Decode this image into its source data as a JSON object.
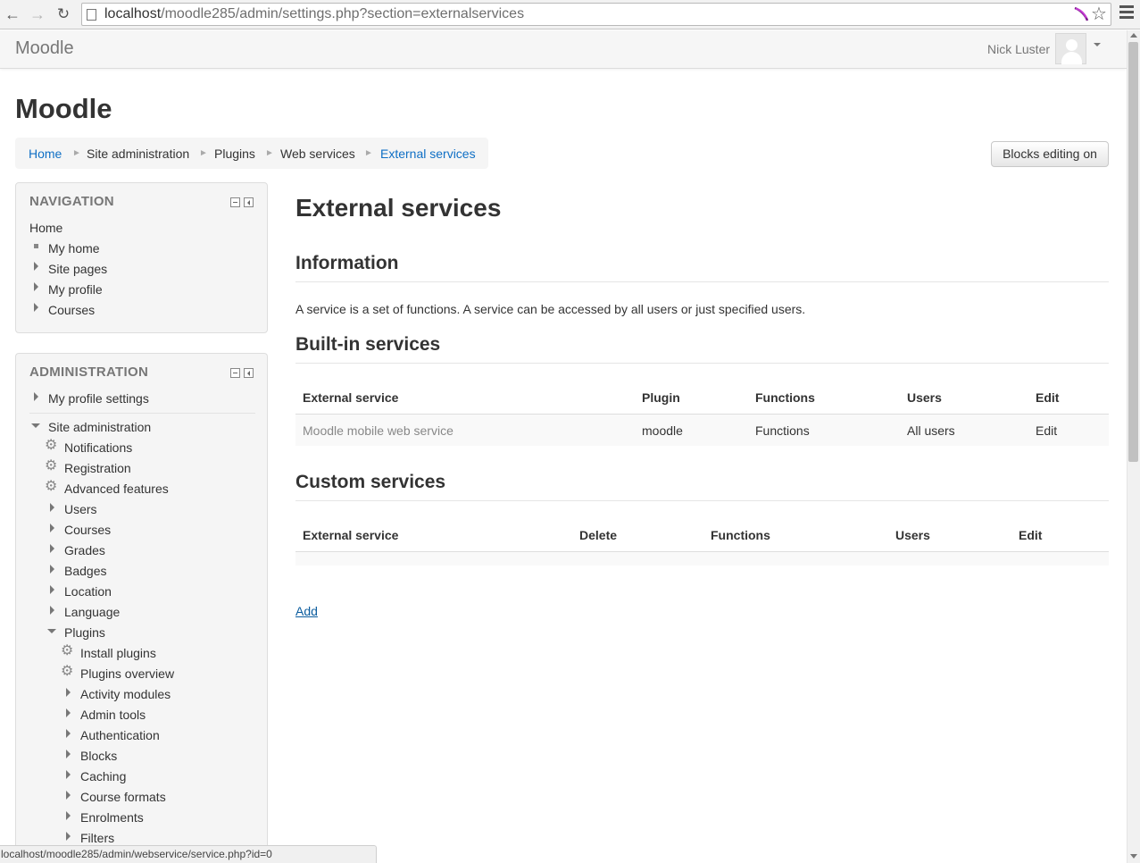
{
  "browser": {
    "url_host": "localhost",
    "url_rest": "/moodle285/admin/settings.php?section=externalservices"
  },
  "navbar": {
    "brand": "Moodle",
    "user_name": "Nick Luster"
  },
  "header": {
    "site_title": "Moodle",
    "blocks_editing_button": "Blocks editing on",
    "breadcrumb": [
      "Home",
      "Site administration",
      "Plugins",
      "Web services",
      "External services"
    ]
  },
  "navigation_block": {
    "title": "NAVIGATION",
    "home": "Home",
    "items": [
      "My home",
      "Site pages",
      "My profile",
      "Courses"
    ]
  },
  "admin_block": {
    "title": "ADMINISTRATION",
    "my_profile_settings": "My profile settings",
    "site_administration": "Site administration",
    "settings_links": [
      "Notifications",
      "Registration",
      "Advanced features"
    ],
    "categories": [
      "Users",
      "Courses",
      "Grades",
      "Badges",
      "Location",
      "Language"
    ],
    "plugins": "Plugins",
    "plugin_links": [
      "Install plugins",
      "Plugins overview"
    ],
    "plugin_categories": [
      "Activity modules",
      "Admin tools",
      "Authentication",
      "Blocks",
      "Caching",
      "Course formats",
      "Enrolments",
      "Filters"
    ]
  },
  "main": {
    "title": "External services",
    "information_heading": "Information",
    "information_text": "A service is a set of functions. A service can be accessed by all users or just specified users.",
    "builtin_heading": "Built-in services",
    "builtin_table": {
      "headers": [
        "External service",
        "Plugin",
        "Functions",
        "Users",
        "Edit"
      ],
      "rows": [
        {
          "service": "Moodle mobile web service",
          "plugin": "moodle",
          "functions": "Functions",
          "users": "All users",
          "edit": "Edit"
        }
      ]
    },
    "custom_heading": "Custom services",
    "custom_table": {
      "headers": [
        "External service",
        "Delete",
        "Functions",
        "Users",
        "Edit"
      ]
    },
    "add_link": "Add"
  },
  "status_bar": "localhost/moodle285/admin/webservice/service.php?id=0"
}
